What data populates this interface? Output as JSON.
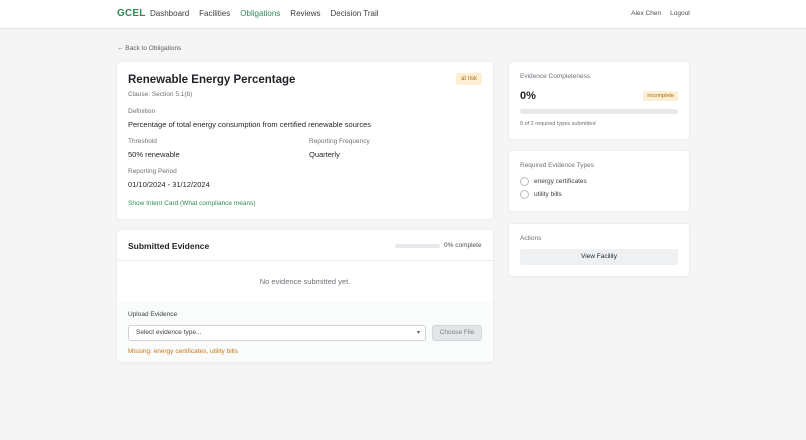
{
  "nav": {
    "brand": "GCEL",
    "items": [
      {
        "label": "Dashboard"
      },
      {
        "label": "Facilities"
      },
      {
        "label": "Obligations"
      },
      {
        "label": "Reviews"
      },
      {
        "label": "Decision Trail"
      }
    ],
    "active": "Obligations",
    "user_name": "Alex Chen",
    "logout_label": "Logout"
  },
  "back_link": "← Back to Obligations",
  "obligation": {
    "title": "Renewable Energy Percentage",
    "status_badge": "at risk",
    "clause": "Clause: Section 5.1(b)",
    "definition_label": "Definition",
    "definition": "Percentage of total energy consumption from certified renewable sources",
    "threshold_label": "Threshold",
    "threshold": "50% renewable",
    "frequency_label": "Reporting Frequency",
    "frequency": "Quarterly",
    "period_label": "Reporting Period",
    "period": "01/10/2024 - 31/12/2024",
    "intent_link": "Show Intent Card (What compliance means)"
  },
  "submitted_evidence": {
    "title": "Submitted Evidence",
    "progress_percent": 0,
    "progress_text": "0% complete",
    "empty_message": "No evidence submitted yet.",
    "upload_label": "Upload Evidence",
    "select_placeholder": "Select evidence type...",
    "choose_file_label": "Choose File",
    "missing_text": "Missing: energy certificates, utility bills"
  },
  "completeness": {
    "label": "Evidence Completeness",
    "percent_text": "0%",
    "percent": 0,
    "badge": "incomplete",
    "sub_text": "0 of 2 required types submitted"
  },
  "required_types": {
    "label": "Required Evidence Types",
    "items": [
      {
        "label": "energy certificates",
        "checked": false
      },
      {
        "label": "utility bills",
        "checked": false
      }
    ]
  },
  "actions": {
    "label": "Actions",
    "view_facility": "View Facility"
  }
}
